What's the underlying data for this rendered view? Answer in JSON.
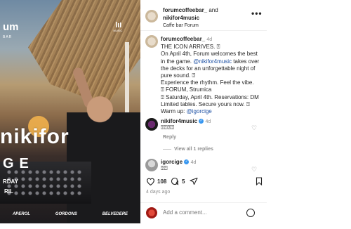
{
  "post_image": {
    "logo_left": "um",
    "logo_left_sub": "BAR",
    "logo_right": "MUSIC",
    "artist": "nikifor",
    "subtitle": "GE",
    "day": "RDAY",
    "month": "RIL",
    "sponsors": [
      "APEROL",
      "GORDONS",
      "BELVEDERE"
    ]
  },
  "header": {
    "author1": "forumcoffeebar_",
    "joiner": " and",
    "author2": "nikifor4music",
    "location": "Caffe bar Forum",
    "more_icon": "more-dots-icon"
  },
  "caption": {
    "username": "forumcoffeebar_",
    "time": "4d",
    "line1": "THE ICON ARRIVES. ⍰",
    "line2_a": "On April 4th, Forum welcomes the best in the game. ",
    "mention": "@nikifor4music",
    "line2_b": " takes over the decks for an unforgettable night of pure sound. ⍰",
    "line3": "Experience the rhythm. Feel the vibe.",
    "line4": "⍰ FORUM, Strumica",
    "line5": "⍰ Saturday, April 4th.  Reservations: DM Limited tables. Secure yours now. ⍰  Warm up: ",
    "mention2": "@igorcige"
  },
  "comments": [
    {
      "username": "nikifor4music",
      "time": "4d",
      "text": "⍰⍰⍰⍰",
      "reply_label": "Reply",
      "view_replies": "View all 1 replies"
    },
    {
      "username": "igorcige",
      "time": "4d",
      "text": "⍰⍰"
    }
  ],
  "actions": {
    "likes": "108",
    "comments": "5"
  },
  "time_ago": "4 days ago",
  "add_comment_placeholder": "Add a comment..."
}
